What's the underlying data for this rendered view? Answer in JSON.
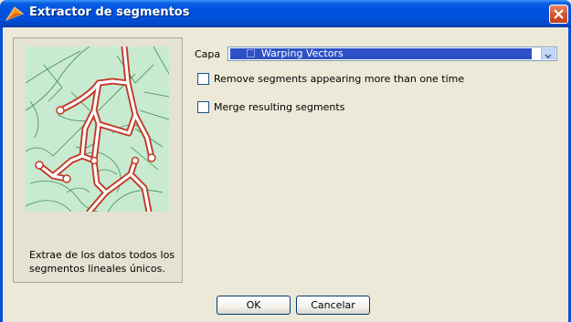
{
  "window": {
    "title": "Extractor de segmentos",
    "icon": "app-arrow-icon"
  },
  "colors": {
    "titlebar": "#0054e3",
    "dialog_bg": "#ece9d8",
    "map_bg": "#c8ead0",
    "map_road": "#c23a2a",
    "selection": "#2d50c6"
  },
  "left_panel": {
    "description": "Extrae de los datos todos los segmentos lineales únicos."
  },
  "form": {
    "layer_label": "Capa",
    "layer_value": "Warping Vectors",
    "remove_duplicates_label": "Remove segments appearing more than one time",
    "remove_duplicates_checked": false,
    "merge_label": "Merge resulting segments",
    "merge_checked": false
  },
  "buttons": {
    "ok": "OK",
    "cancel": "Cancelar"
  }
}
